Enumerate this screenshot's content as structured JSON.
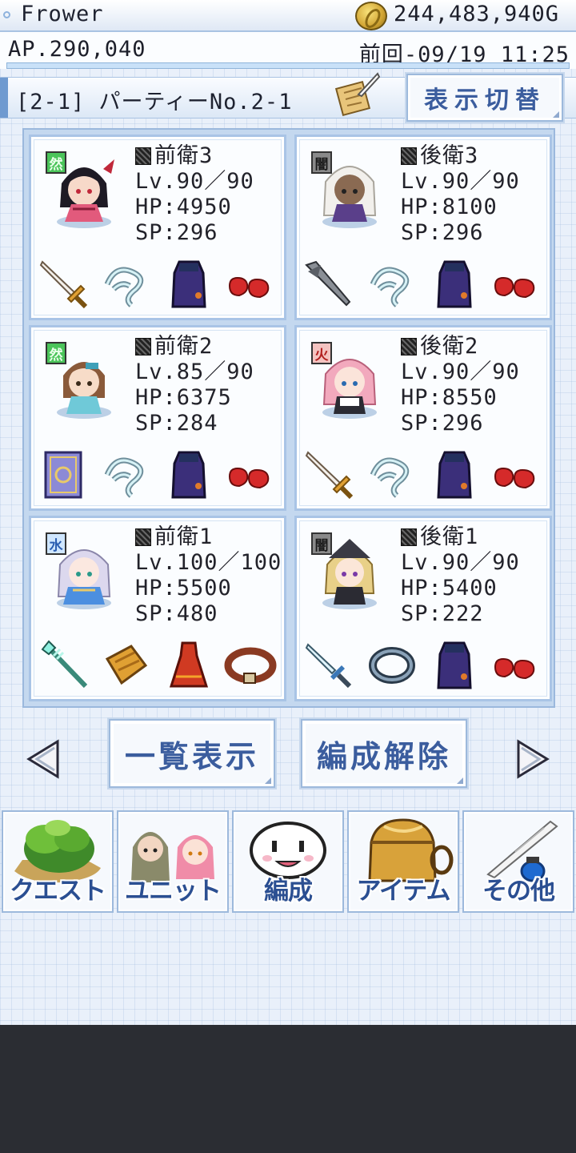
{
  "header": {
    "player_name": "Frower",
    "gold": "244,483,940G",
    "ap": "AP.290,040",
    "last_login": "前回-09/19 11:25"
  },
  "party": {
    "title": "[2-1] パーティーNo.2-1",
    "toggle_label": "表示切替"
  },
  "units": [
    {
      "position": "前衛3",
      "level": "Lv.90／90",
      "hp": "HP:4950",
      "sp": "SP:296",
      "element": "然",
      "element_icon": "nature-element-icon",
      "equipment": [
        "sword-icon",
        "scarf-icon",
        "cloak-icon",
        "boots-icon"
      ]
    },
    {
      "position": "後衛3",
      "level": "Lv.90／90",
      "hp": "HP:8100",
      "sp": "SP:296",
      "element": "闇",
      "element_icon": "dark-element-icon",
      "equipment": [
        "spear-icon",
        "scarf-icon",
        "cloak-icon",
        "boots-icon"
      ]
    },
    {
      "position": "前衛2",
      "level": "Lv.85／90",
      "hp": "HP:6375",
      "sp": "SP:284",
      "element": "然",
      "element_icon": "nature-element-icon",
      "equipment": [
        "spellbook-icon",
        "scarf-icon",
        "cloak-icon",
        "boots-icon"
      ]
    },
    {
      "position": "後衛2",
      "level": "Lv.90／90",
      "hp": "HP:8550",
      "sp": "SP:296",
      "element": "火",
      "element_icon": "fire-element-icon",
      "equipment": [
        "sword-icon",
        "scarf-icon",
        "cloak-icon",
        "boots-icon"
      ]
    },
    {
      "position": "前衛1",
      "level": "Lv.100／100",
      "hp": "HP:5500",
      "sp": "SP:480",
      "element": "水",
      "element_icon": "water-element-icon",
      "equipment": [
        "staff-icon",
        "bracer-icon",
        "dress-icon",
        "belt-icon"
      ]
    },
    {
      "position": "後衛1",
      "level": "Lv.90／90",
      "hp": "HP:5400",
      "sp": "SP:222",
      "element": "闇",
      "element_icon": "dark-element-icon",
      "equipment": [
        "dagger-icon",
        "ring-icon",
        "cloak-icon",
        "boots-icon"
      ]
    }
  ],
  "nav": {
    "list_view_label": "一覧表示",
    "disband_label": "編成解除",
    "prev_icon": "triangle-left-icon",
    "next_icon": "triangle-right-icon"
  },
  "menu": [
    {
      "label": "クエスト",
      "icon": "tree-icon"
    },
    {
      "label": "ユニット",
      "icon": "units-icon"
    },
    {
      "label": "編成",
      "icon": "face-icon"
    },
    {
      "label": "アイテム",
      "icon": "bag-icon"
    },
    {
      "label": "その他",
      "icon": "quill-icon"
    }
  ],
  "colors": {
    "accent": "#3b5d9e",
    "panel_border": "#9db9dc",
    "background": "#e9f0fa"
  }
}
